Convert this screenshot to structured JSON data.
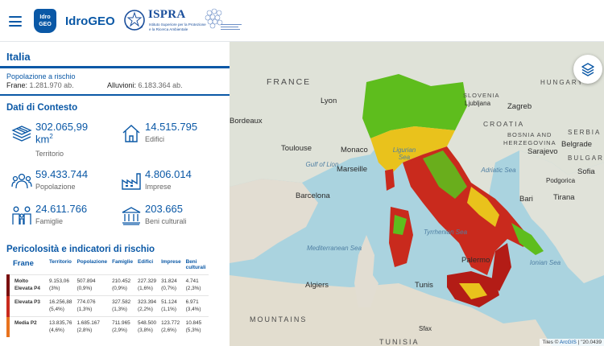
{
  "header": {
    "logo_badge_line1": "Idro",
    "logo_badge_line2": "GEO",
    "app_name": "IdroGEO",
    "ispra_name": "ISPRA",
    "ispra_sub1": "Istituto Superiore per la Protezione",
    "ispra_sub2": "e la Ricerca Ambientale"
  },
  "panel": {
    "region": "Italia",
    "population_at_risk_label": "Popolazione a rischio",
    "frane_label": "Frane:",
    "frane_value": "1.281.970 ab.",
    "alluvioni_label": "Alluvioni:",
    "alluvioni_value": "6.183.364 ab.",
    "context_title": "Dati di Contesto",
    "stats": {
      "territorio_value": "302.065,99",
      "territorio_unit": "km",
      "territorio_sup": "2",
      "territorio_label": "Territorio",
      "edifici_value": "14.515.795",
      "edifici_label": "Edifici",
      "popolazione_value": "59.433.744",
      "popolazione_label": "Popolazione",
      "imprese_value": "4.806.014",
      "imprese_label": "Imprese",
      "famiglie_value": "24.611.766",
      "famiglie_label": "Famiglie",
      "beni_value": "203.665",
      "beni_label": "Beni culturali"
    },
    "risk_title": "Pericolosità e indicatori di rischio",
    "risk_table": {
      "headers": [
        "Frane",
        "Territorio",
        "Popolazione",
        "Famiglie",
        "Edifici",
        "Imprese",
        "Beni culturali"
      ],
      "rows": [
        {
          "cls": "Molto Elevata P4",
          "color": "#7a0f0f",
          "values": [
            "9.153,06",
            "507.894",
            "210.452",
            "227.329",
            "31.824",
            "4.741"
          ],
          "pcts": [
            "(3%)",
            "(0,9%)",
            "(0,9%)",
            "(1,6%)",
            "(0,7%)",
            "(2,3%)"
          ]
        },
        {
          "cls": "Elevata P3",
          "color": "#c92a1d",
          "values": [
            "16.256,88",
            "774.076",
            "327.582",
            "323.394",
            "51.124",
            "6.971"
          ],
          "pcts": [
            "(5,4%)",
            "(1,3%)",
            "(1,3%)",
            "(2,2%)",
            "(1,1%)",
            "(3,4%)"
          ]
        },
        {
          "cls": "Media P2",
          "color": "#e8731e",
          "values": [
            "13.835,76",
            "1.685.167",
            "711.965",
            "548.500",
            "123.772",
            "10.845"
          ],
          "pcts": [
            "(4,6%)",
            "(2,8%)",
            "(2,9%)",
            "(3,8%)",
            "(2,6%)",
            "(5,3%)"
          ]
        }
      ]
    }
  },
  "map": {
    "labels": {
      "france": "FRANCE",
      "hungary": "HUNGARY",
      "slovenia": "SLOVENIA",
      "croatia": "CROATIA",
      "bosnia": "BOSNIA AND",
      "herzegovina": "HERZEGOVINA",
      "serbia": "SERBIA",
      "bulgaria": "BULGARIA",
      "mountains": "MOUNTAINS",
      "tunisia": "TUNISIA",
      "lyon": "Lyon",
      "bordeaux": "Bordeaux",
      "toulouse": "Toulouse",
      "monaco": "Monaco",
      "marseille": "Marseille",
      "barcelona": "Barcelona",
      "ljubljana": "Ljubljana",
      "zagreb": "Zagreb",
      "belgrade": "Belgrade",
      "sarajevo": "Sarajevo",
      "sofia": "Sofia",
      "podgorica": "Podgorica",
      "bari": "Bari",
      "tirana": "Tirana",
      "palermo": "Palermo",
      "algiers": "Algiers",
      "tunis": "Tunis",
      "sfax": "Sfax",
      "lion": "Gulf of Lion",
      "ligurian": "Ligurian Sea",
      "adriatic": "Adriatic Sea",
      "tyrrhenian": "Tyrrhenian Sea",
      "mediterranean": "Mediterranean Sea",
      "ionian": "Ionian Sea"
    },
    "attribution_prefix": "Tiles ©",
    "attribution_link": "ArcGIS",
    "coords": "\"20.0439"
  },
  "colors": {
    "brand_blue": "#0a58a6",
    "risk_green": "#5ebd1d",
    "risk_yellow": "#e9c21c",
    "risk_orange": "#e0651f",
    "risk_red": "#b31c16"
  }
}
